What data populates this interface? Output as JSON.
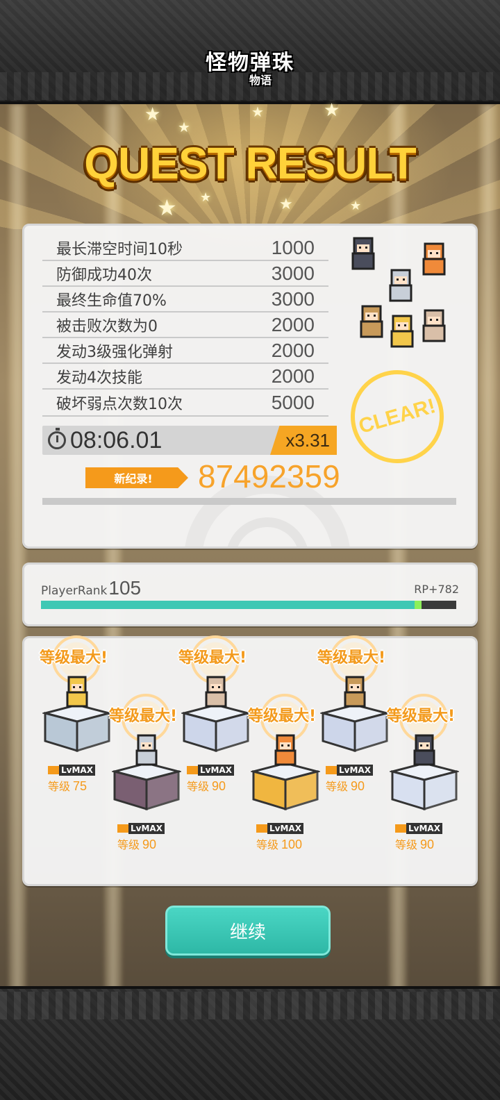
{
  "logo": {
    "main": "怪物弹珠",
    "sub": "物语"
  },
  "title": "QUEST RESULT",
  "quest_results": [
    {
      "label": "最长滞空时间10秒",
      "points": "1000"
    },
    {
      "label": "防御成功40次",
      "points": "3000"
    },
    {
      "label": "最终生命值70%",
      "points": "3000"
    },
    {
      "label": "被击败次数为0",
      "points": "2000"
    },
    {
      "label": "发动3级强化弹射",
      "points": "2000"
    },
    {
      "label": "发动4次技能",
      "points": "2000"
    },
    {
      "label": "破坏弱点次数10次",
      "points": "5000"
    }
  ],
  "clear_time": "08:06.01",
  "multiplier": "x3.31",
  "clear_stamp": "CLEAR!",
  "new_record_label": "新纪录!",
  "score": "87492359",
  "player_rank": {
    "label": "PlayerRank",
    "value": "105",
    "rp": "RP+782",
    "progress": 0.9,
    "gain": 0.017
  },
  "level_max_text": "等级最大!",
  "lvmax_badge": "LvMAX",
  "level_label": "等级",
  "characters": [
    {
      "name": "blonde-blue-bow-girl",
      "level": "75",
      "pedestal_color": "#b9c8d6",
      "sprite_color": "#f2c74b"
    },
    {
      "name": "silver-haired-knight",
      "level": "90",
      "pedestal_color": "#7a5f72",
      "sprite_color": "#c8cfd8"
    },
    {
      "name": "grey-haired-girl",
      "level": "90",
      "pedestal_color": "#cdd6ea",
      "sprite_color": "#d9bfa8"
    },
    {
      "name": "orange-haired-fighter",
      "level": "100",
      "pedestal_color": "#f0b640",
      "sprite_color": "#f08a3a"
    },
    {
      "name": "staff-wielding-sage",
      "level": "90",
      "pedestal_color": "#cdd6ea",
      "sprite_color": "#c89a5a"
    },
    {
      "name": "dark-winged-demon",
      "level": "90",
      "pedestal_color": "#d8e0f0",
      "sprite_color": "#4a4d5c"
    }
  ],
  "party_icons": [
    {
      "name": "demon-sprite",
      "color": "#4a4d5c"
    },
    {
      "name": "orange-girl-sprite",
      "color": "#f08a3a"
    },
    {
      "name": "knight-sprite",
      "color": "#c8cfd8"
    },
    {
      "name": "sage-sprite",
      "color": "#c89a5a"
    },
    {
      "name": "blonde-sprite",
      "color": "#f2c74b"
    },
    {
      "name": "grey-girl-sprite",
      "color": "#d9bfa8"
    }
  ],
  "continue_label": "继续",
  "colors": {
    "accent": "#f59a1b",
    "teal": "#3ec8b4",
    "gold": "#ffd23a"
  }
}
